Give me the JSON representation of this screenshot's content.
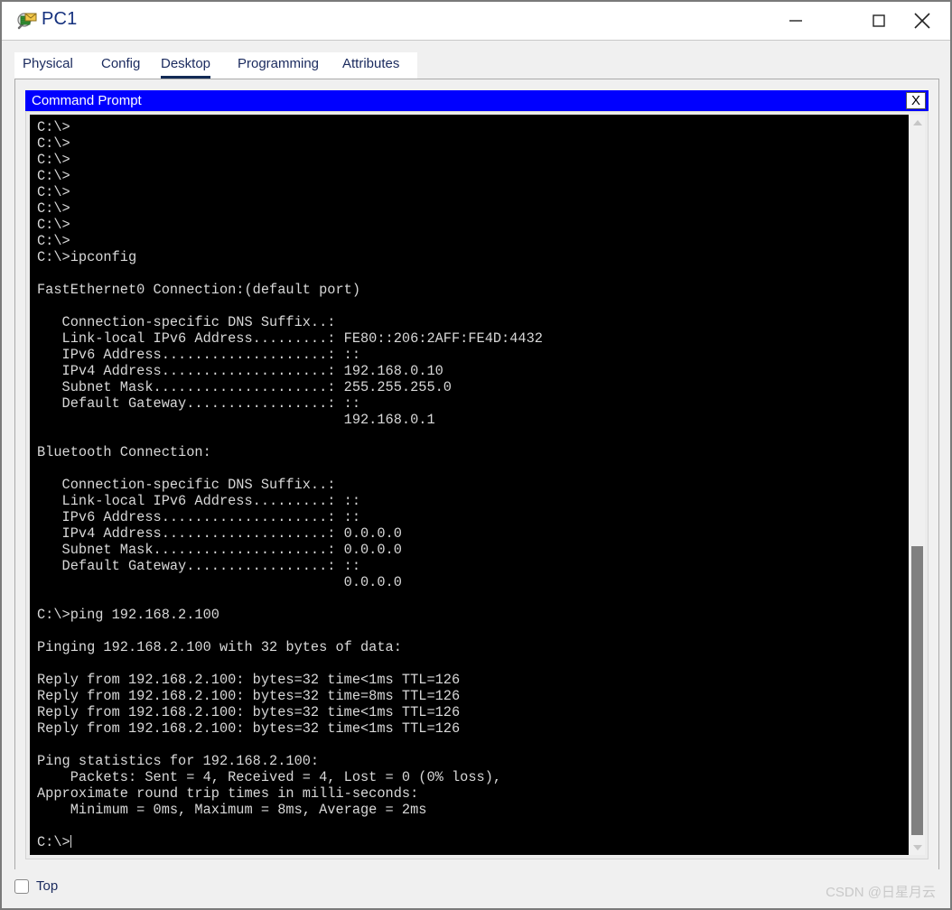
{
  "window": {
    "title": "PC1",
    "icon": "packet-tracer-pc-icon",
    "controls": {
      "minimize": "—",
      "maximize": "☐",
      "close": "✕"
    }
  },
  "tabs": [
    {
      "label": "Physical",
      "selected": false
    },
    {
      "label": "Config",
      "selected": false
    },
    {
      "label": "Desktop",
      "selected": true
    },
    {
      "label": "Programming",
      "selected": false
    },
    {
      "label": "Attributes",
      "selected": false
    }
  ],
  "command_prompt": {
    "title": "Command Prompt",
    "close_label": "X",
    "terminal_text": "C:\\>\nC:\\>\nC:\\>\nC:\\>\nC:\\>\nC:\\>\nC:\\>\nC:\\>\nC:\\>ipconfig\n\nFastEthernet0 Connection:(default port)\n\n   Connection-specific DNS Suffix..:\n   Link-local IPv6 Address.........: FE80::206:2AFF:FE4D:4432\n   IPv6 Address....................: ::\n   IPv4 Address....................: 192.168.0.10\n   Subnet Mask.....................: 255.255.255.0\n   Default Gateway.................: ::\n                                     192.168.0.1\n\nBluetooth Connection:\n\n   Connection-specific DNS Suffix..:\n   Link-local IPv6 Address.........: ::\n   IPv6 Address....................: ::\n   IPv4 Address....................: 0.0.0.0\n   Subnet Mask.....................: 0.0.0.0\n   Default Gateway.................: ::\n                                     0.0.0.0\n\nC:\\>ping 192.168.2.100\n\nPinging 192.168.2.100 with 32 bytes of data:\n\nReply from 192.168.2.100: bytes=32 time<1ms TTL=126\nReply from 192.168.2.100: bytes=32 time=8ms TTL=126\nReply from 192.168.2.100: bytes=32 time<1ms TTL=126\nReply from 192.168.2.100: bytes=32 time<1ms TTL=126\n\nPing statistics for 192.168.2.100:\n    Packets: Sent = 4, Received = 4, Lost = 0 (0% loss),\nApproximate round trip times in milli-seconds:\n    Minimum = 0ms, Maximum = 8ms, Average = 2ms\n\nC:\\>"
  },
  "bottom": {
    "top_checkbox_label": "Top",
    "top_checkbox_checked": false,
    "watermark": "CSDN @日星月云"
  },
  "colors": {
    "cmd_titlebar": "#0000ff",
    "terminal_bg": "#000000",
    "terminal_fg": "#d8d8d8",
    "tab_text": "#1a2a5e",
    "window_bg": "#f0f0f0",
    "scrollbar_thumb": "#808080"
  }
}
